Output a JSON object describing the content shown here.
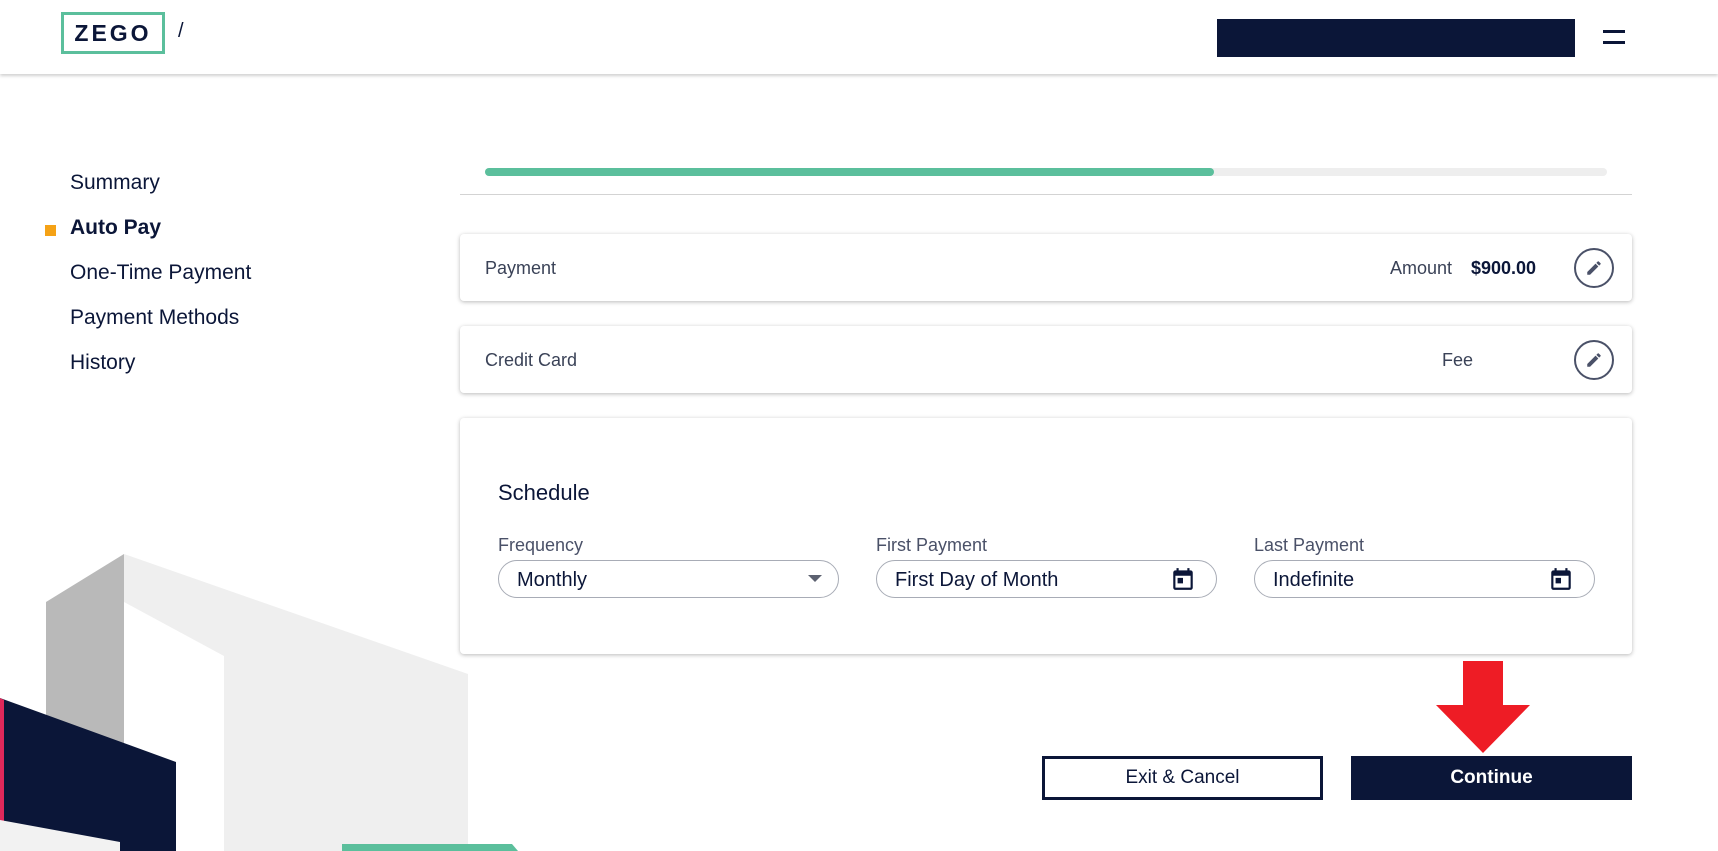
{
  "header": {
    "logo_text": "ZEGO",
    "breadcrumb_separator": "/"
  },
  "colors": {
    "brand_navy": "#0b1638",
    "accent_green": "#5bbf9c",
    "active_marker": "#f5a216",
    "annotation_red": "#ee1c25"
  },
  "sidebar": {
    "items": [
      {
        "label": "Summary",
        "active": false
      },
      {
        "label": "Auto Pay",
        "active": true
      },
      {
        "label": "One-Time Payment",
        "active": false
      },
      {
        "label": "Payment Methods",
        "active": false
      },
      {
        "label": "History",
        "active": false
      }
    ]
  },
  "progress": {
    "fraction": 0.65
  },
  "payment_card": {
    "label": "Payment",
    "amount_label": "Amount",
    "amount_value": "$900.00",
    "edit_icon": "pencil-icon"
  },
  "credit_card": {
    "label": "Credit Card",
    "fee_label": "Fee",
    "edit_icon": "pencil-icon"
  },
  "schedule": {
    "title": "Schedule",
    "frequency_label": "Frequency",
    "frequency_value": "Monthly",
    "first_payment_label": "First Payment",
    "first_payment_value": "First Day of Month",
    "last_payment_label": "Last Payment",
    "last_payment_value": "Indefinite",
    "calendar_icon": "calendar-icon"
  },
  "actions": {
    "exit_label": "Exit & Cancel",
    "continue_label": "Continue"
  }
}
